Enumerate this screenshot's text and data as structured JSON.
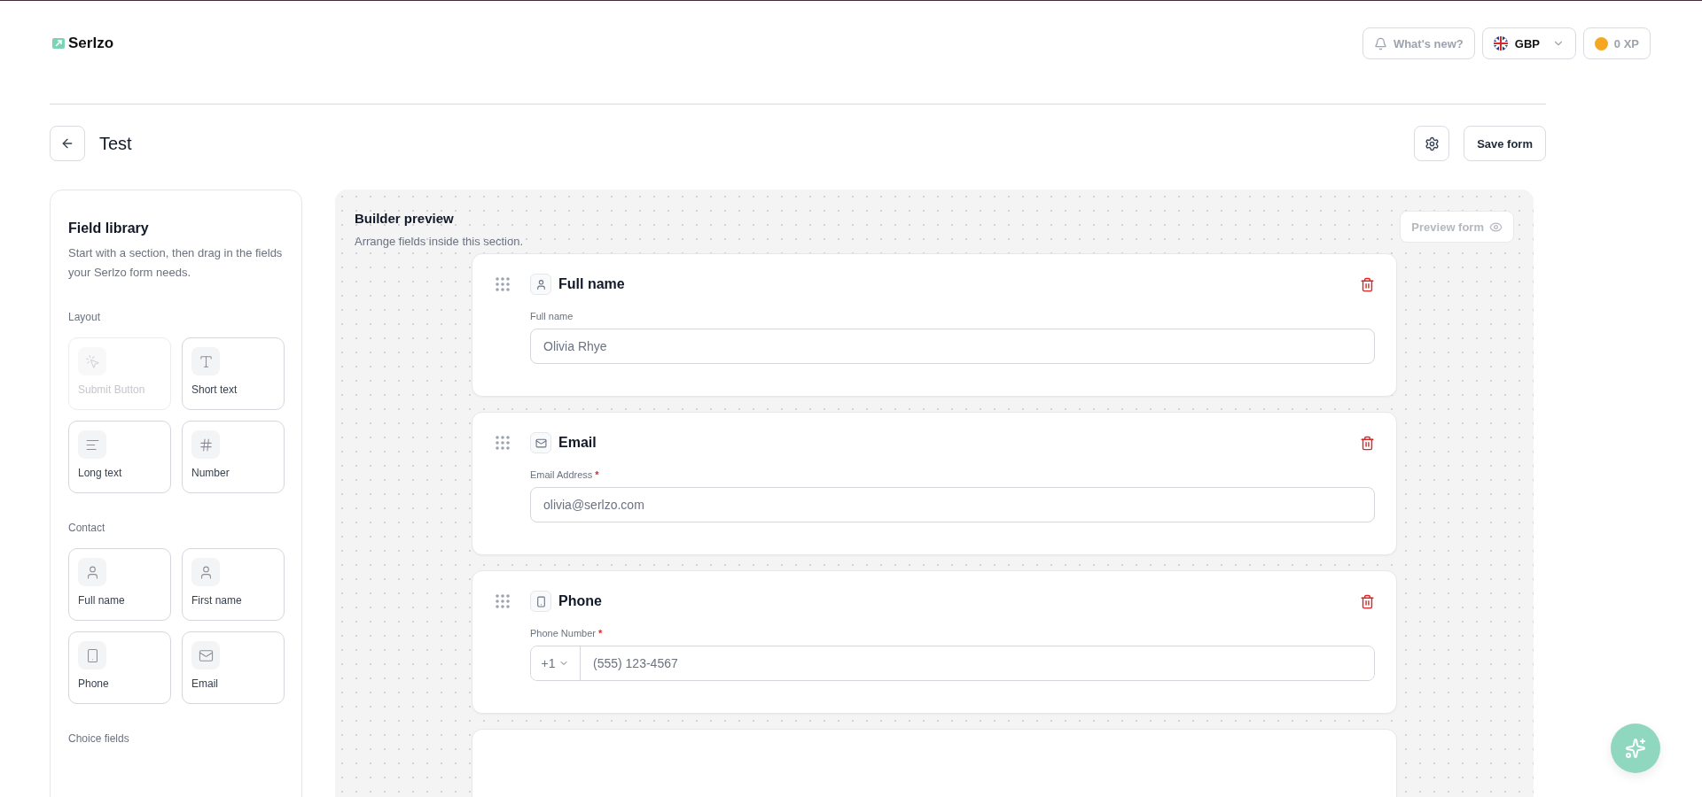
{
  "app": {
    "logo": "Serlzo"
  },
  "header": {
    "whats_new": "What's new?",
    "currency": "GBP",
    "xp": "0 XP"
  },
  "page": {
    "title": "Test",
    "save_button": "Save form"
  },
  "library": {
    "title": "Field library",
    "description": "Start with a section, then drag in the fields your Serlzo form needs.",
    "groups": [
      {
        "label": "Layout",
        "items": [
          {
            "label": "Submit Button",
            "kind": "submit",
            "disabled": true
          },
          {
            "label": "Short text",
            "kind": "short_text",
            "disabled": false
          },
          {
            "label": "Long text",
            "kind": "long_text",
            "disabled": false
          },
          {
            "label": "Number",
            "kind": "number",
            "disabled": false
          }
        ]
      },
      {
        "label": "Contact",
        "items": [
          {
            "label": "Full name",
            "kind": "full_name",
            "disabled": false
          },
          {
            "label": "First name",
            "kind": "first_name",
            "disabled": false
          },
          {
            "label": "Phone",
            "kind": "phone",
            "disabled": false
          },
          {
            "label": "Email",
            "kind": "email",
            "disabled": false
          }
        ]
      },
      {
        "label": "Choice fields"
      }
    ]
  },
  "preview": {
    "title": "Builder preview",
    "subtitle": "Arrange fields inside this section.",
    "preview_button": {
      "label": "Preview form",
      "disabled": true
    },
    "fields": [
      {
        "kind": "name",
        "title": "Full name",
        "label": "Full name",
        "placeholder": "Olivia Rhye"
      },
      {
        "kind": "email",
        "title": "Email",
        "label": "Email Address",
        "required_mark": "*",
        "placeholder": "olivia@serlzo.com"
      },
      {
        "kind": "phone",
        "title": "Phone",
        "label": "Phone Number",
        "required_mark": "*",
        "country_code": "+1",
        "placeholder": "(555) 123-4567"
      }
    ]
  }
}
